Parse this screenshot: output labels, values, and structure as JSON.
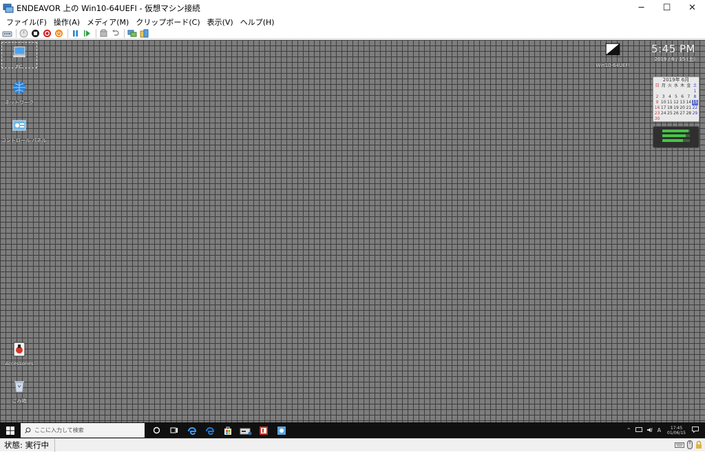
{
  "window": {
    "title": "ENDEAVOR 上の Win10-64UEFI  - 仮想マシン接続",
    "minimize_label": "─",
    "maximize_label": "☐",
    "close_label": "✕"
  },
  "menu": {
    "items": [
      "ファイル(F)",
      "操作(A)",
      "メディア(M)",
      "クリップボード(C)",
      "表示(V)",
      "ヘルプ(H)"
    ]
  },
  "toolbar": {
    "icons": [
      "ctrl-alt-del-icon",
      "start-icon",
      "turn-off-icon",
      "shutdown-icon",
      "save-icon",
      "pause-icon",
      "resume-icon",
      "checkpoint-icon",
      "revert-icon",
      "enhanced-session-icon",
      "share-icon"
    ]
  },
  "desktop": {
    "icons": [
      {
        "name": "pc",
        "label": "PC"
      },
      {
        "name": "network",
        "label": "ネットワーク"
      },
      {
        "name": "control-panel",
        "label": "コントロール パネル"
      },
      {
        "name": "accessories",
        "label": "Accessories"
      },
      {
        "name": "recycle-bin",
        "label": "ごみ箱"
      }
    ],
    "right_icon": {
      "name": "win10-uefi",
      "label": "Win10-64UEFI"
    },
    "clock": {
      "time": "5:45 PM",
      "date": "2019 / 6 / 15 (土)"
    },
    "calendar": {
      "header": "2019年 6月",
      "weekdays": [
        "日",
        "月",
        "火",
        "水",
        "木",
        "金",
        "土"
      ],
      "today": "15",
      "days": [
        "",
        "",
        "",
        "",
        "",
        "",
        "1",
        "2",
        "3",
        "4",
        "5",
        "6",
        "7",
        "8",
        "9",
        "10",
        "11",
        "12",
        "13",
        "14",
        "15",
        "16",
        "17",
        "18",
        "19",
        "20",
        "21",
        "22",
        "23",
        "24",
        "25",
        "26",
        "27",
        "28",
        "29",
        "30",
        "",
        "",
        "",
        "",
        "",
        ""
      ]
    },
    "meter_levels": [
      0.95,
      0.85,
      0.75
    ]
  },
  "taskbar": {
    "search_placeholder": "ここに入力して検索",
    "apps": [
      "cortana-icon",
      "task-view-icon",
      "edge-icon",
      "ie-icon",
      "store-icon",
      "drive-icon",
      "office-icon",
      "app-icon"
    ],
    "tray_input": "A",
    "time": "17:45",
    "date": "01/06/15"
  },
  "statusbar": {
    "status": "状態: 実行中"
  },
  "colors": {
    "desktop_bg": "#7d7d7d",
    "grid_line": "#3d3d3d",
    "taskbar": "#101010",
    "calendar_today": "#5a6fd0",
    "meter_green": "#46c446"
  }
}
